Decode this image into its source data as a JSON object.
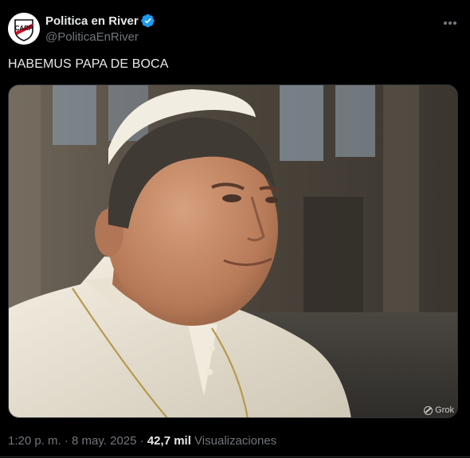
{
  "author": {
    "display_name": "Politica en River",
    "handle": "@PoliticaEnRiver",
    "verified": true,
    "avatar_icon": "river-plate-crest-icon",
    "avatar_letters": "CARP"
  },
  "tweet": {
    "text": "HABEMUS PAPA DE BOCA"
  },
  "media": {
    "watermark": "Grok"
  },
  "meta": {
    "time": "1:20 p. m.",
    "separator": "·",
    "date": "8 may. 2025",
    "views_count": "42,7 mil",
    "views_label": "Visualizaciones"
  },
  "colors": {
    "background": "#000000",
    "text_primary": "#e7e9ea",
    "text_secondary": "#71767b",
    "verified_blue": "#1d9bf0",
    "border": "#2f3336"
  }
}
